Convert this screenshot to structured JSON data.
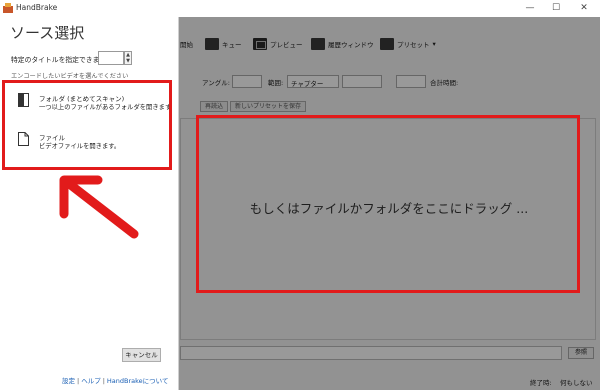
{
  "window": {
    "title": "HandBrake",
    "minimize": "—",
    "maximize": "☐",
    "close": "✕"
  },
  "toolbar": {
    "start": "開始",
    "queue": "キュー",
    "preview": "プレビュー",
    "activity": "履歴ウィンドウ",
    "presets": "プリセット"
  },
  "source_row": {
    "angle": "アングル:",
    "range": "範囲:",
    "range_value": "チャプター",
    "duration": "合計時間:"
  },
  "preset_buttons": {
    "reload": "再読込",
    "save_new": "新しいプリセットを保存"
  },
  "drop_text": "もしくはファイルかフォルダをここにドラッグ ...",
  "destination": {
    "browse": "参照"
  },
  "status": {
    "when_done_label": "終了時:",
    "when_done_value": "何もしない"
  },
  "panel": {
    "title": "ソース選択",
    "title_spec": "特定のタイトルを指定できます:",
    "hint": "エンコードしたいビデオを選んでください",
    "folder": {
      "title": "フォルダ (まとめてスキャン)",
      "desc": "一つ以上のファイルがあるフォルダを開きます"
    },
    "file": {
      "title": "ファイル",
      "desc": "ビデオファイルを開きます。"
    },
    "cancel": "キャンセル",
    "links": {
      "settings": "設定",
      "help": "ヘルプ",
      "about": "HandBrakeについて",
      "sep": "|"
    }
  },
  "annotation_color": "#e21b1b"
}
